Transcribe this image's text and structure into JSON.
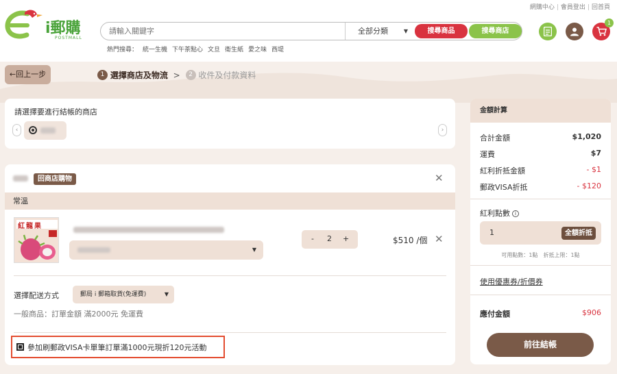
{
  "top_links": [
    "網購中心",
    "會員登出",
    "回首頁"
  ],
  "logo": {
    "text": "i郵購",
    "subtext": "POSTMALL"
  },
  "search": {
    "placeholder": "請輸入關鍵字",
    "category": "全部分類",
    "search_products_label": "搜尋商品",
    "search_stores_label": "搜尋商店"
  },
  "hot_search": {
    "label": "熱門搜尋：",
    "items": [
      "統一生機",
      "下午茶點心",
      "文旦",
      "衛生紙",
      "愛之味",
      "西堤"
    ]
  },
  "header_icons": [
    "list-icon",
    "user-icon",
    "cart-icon"
  ],
  "cart_count": "1",
  "back_label": "←回上一步",
  "steps": [
    {
      "num": "1",
      "label": "選擇商店及物流",
      "active": true
    },
    {
      "num": "2",
      "label": "收件及付款資料",
      "active": false
    }
  ],
  "store_select": {
    "title": "請選擇要進行結帳的商店"
  },
  "store_card": {
    "return_label": "回商店購物",
    "temperature": "常溫",
    "product": {
      "image_text": "紅龍果",
      "quantity": "2",
      "qty_minus": "-",
      "qty_plus": "+",
      "price": "$510 /個"
    },
    "shipping": {
      "label": "選擇配送方式",
      "selected": "郵局 i 郵箱取貨(免運費)",
      "note": "一般商品：訂單金額 滿2000元 免運費"
    },
    "promo": {
      "label": "參加刷郵政VISA卡單筆訂單滿1000元現折120元活動",
      "checked": true
    }
  },
  "summary": {
    "title": "金額計算",
    "rows": [
      {
        "label": "合計金額",
        "value": "$1,020",
        "red": false
      },
      {
        "label": "運費",
        "value": "$7",
        "red": false
      },
      {
        "label": "紅利折抵金額",
        "value": "- $1",
        "red": true
      },
      {
        "label": "郵政VISA折抵",
        "value": "- $120",
        "red": true
      }
    ],
    "points_title": "紅利點數",
    "points_info": "i",
    "points_value": "1",
    "points_button": "全額折抵",
    "points_note": "可用點數：1點　折抵上限：1點",
    "coupon_link": "使用優惠券/折價券",
    "due_label": "應付金額",
    "due_value": "$906",
    "checkout_label": "前往結帳"
  },
  "colors": {
    "brand_brown": "#7a5a48",
    "accent_red": "#d9333f",
    "accent_green": "#8bc34a",
    "light_beige": "#efe0d6",
    "promo_border": "#e34b2e"
  }
}
